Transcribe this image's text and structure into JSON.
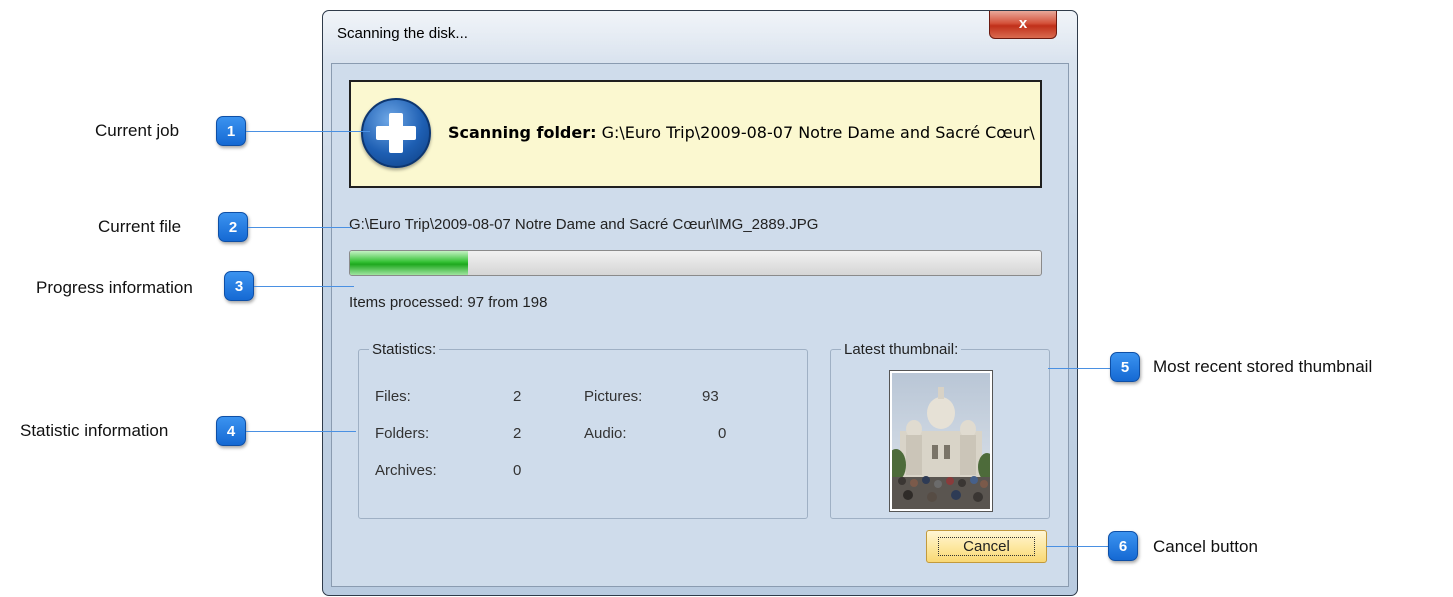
{
  "window": {
    "title": "Scanning the disk...",
    "close_label": "x"
  },
  "job": {
    "label": "Scanning folder:",
    "path": "G:\\Euro Trip\\2009-08-07 Notre Dame and Sacré Cœur\\"
  },
  "current_file": "G:\\Euro Trip\\2009-08-07 Notre Dame and Sacré Cœur\\IMG_2889.JPG",
  "progress": {
    "processed": 97,
    "total": 198,
    "text": "Items processed: 97 from 198"
  },
  "statistics": {
    "legend": "Statistics:",
    "files_label": "Files:",
    "files_value": "2",
    "folders_label": "Folders:",
    "folders_value": "2",
    "archives_label": "Archives:",
    "archives_value": "0",
    "pictures_label": "Pictures:",
    "pictures_value": "93",
    "audio_label": "Audio:",
    "audio_value": "0"
  },
  "thumbnail": {
    "legend": "Latest thumbnail:"
  },
  "cancel_label": "Cancel",
  "callouts": [
    {
      "number": "1",
      "label": "Current job"
    },
    {
      "number": "2",
      "label": "Current file"
    },
    {
      "number": "3",
      "label": "Progress information"
    },
    {
      "number": "4",
      "label": "Statistic information"
    },
    {
      "number": "5",
      "label": "Most recent stored thumbnail"
    },
    {
      "number": "6",
      "label": "Cancel button"
    }
  ],
  "colors": {
    "accent": "#1569d3",
    "progress_fill": "#36c236",
    "job_panel_bg": "#fbf8d0",
    "client_bg": "#cfdceb"
  }
}
